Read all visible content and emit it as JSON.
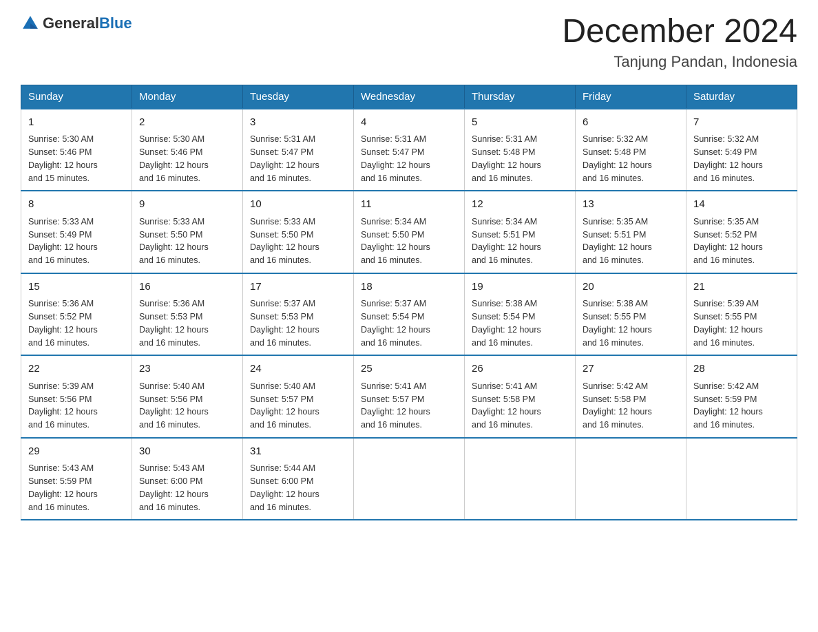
{
  "logo": {
    "text_general": "General",
    "text_blue": "Blue"
  },
  "title": "December 2024",
  "subtitle": "Tanjung Pandan, Indonesia",
  "headers": [
    "Sunday",
    "Monday",
    "Tuesday",
    "Wednesday",
    "Thursday",
    "Friday",
    "Saturday"
  ],
  "weeks": [
    [
      {
        "day": "1",
        "info": "Sunrise: 5:30 AM\nSunset: 5:46 PM\nDaylight: 12 hours\nand 15 minutes."
      },
      {
        "day": "2",
        "info": "Sunrise: 5:30 AM\nSunset: 5:46 PM\nDaylight: 12 hours\nand 16 minutes."
      },
      {
        "day": "3",
        "info": "Sunrise: 5:31 AM\nSunset: 5:47 PM\nDaylight: 12 hours\nand 16 minutes."
      },
      {
        "day": "4",
        "info": "Sunrise: 5:31 AM\nSunset: 5:47 PM\nDaylight: 12 hours\nand 16 minutes."
      },
      {
        "day": "5",
        "info": "Sunrise: 5:31 AM\nSunset: 5:48 PM\nDaylight: 12 hours\nand 16 minutes."
      },
      {
        "day": "6",
        "info": "Sunrise: 5:32 AM\nSunset: 5:48 PM\nDaylight: 12 hours\nand 16 minutes."
      },
      {
        "day": "7",
        "info": "Sunrise: 5:32 AM\nSunset: 5:49 PM\nDaylight: 12 hours\nand 16 minutes."
      }
    ],
    [
      {
        "day": "8",
        "info": "Sunrise: 5:33 AM\nSunset: 5:49 PM\nDaylight: 12 hours\nand 16 minutes."
      },
      {
        "day": "9",
        "info": "Sunrise: 5:33 AM\nSunset: 5:50 PM\nDaylight: 12 hours\nand 16 minutes."
      },
      {
        "day": "10",
        "info": "Sunrise: 5:33 AM\nSunset: 5:50 PM\nDaylight: 12 hours\nand 16 minutes."
      },
      {
        "day": "11",
        "info": "Sunrise: 5:34 AM\nSunset: 5:50 PM\nDaylight: 12 hours\nand 16 minutes."
      },
      {
        "day": "12",
        "info": "Sunrise: 5:34 AM\nSunset: 5:51 PM\nDaylight: 12 hours\nand 16 minutes."
      },
      {
        "day": "13",
        "info": "Sunrise: 5:35 AM\nSunset: 5:51 PM\nDaylight: 12 hours\nand 16 minutes."
      },
      {
        "day": "14",
        "info": "Sunrise: 5:35 AM\nSunset: 5:52 PM\nDaylight: 12 hours\nand 16 minutes."
      }
    ],
    [
      {
        "day": "15",
        "info": "Sunrise: 5:36 AM\nSunset: 5:52 PM\nDaylight: 12 hours\nand 16 minutes."
      },
      {
        "day": "16",
        "info": "Sunrise: 5:36 AM\nSunset: 5:53 PM\nDaylight: 12 hours\nand 16 minutes."
      },
      {
        "day": "17",
        "info": "Sunrise: 5:37 AM\nSunset: 5:53 PM\nDaylight: 12 hours\nand 16 minutes."
      },
      {
        "day": "18",
        "info": "Sunrise: 5:37 AM\nSunset: 5:54 PM\nDaylight: 12 hours\nand 16 minutes."
      },
      {
        "day": "19",
        "info": "Sunrise: 5:38 AM\nSunset: 5:54 PM\nDaylight: 12 hours\nand 16 minutes."
      },
      {
        "day": "20",
        "info": "Sunrise: 5:38 AM\nSunset: 5:55 PM\nDaylight: 12 hours\nand 16 minutes."
      },
      {
        "day": "21",
        "info": "Sunrise: 5:39 AM\nSunset: 5:55 PM\nDaylight: 12 hours\nand 16 minutes."
      }
    ],
    [
      {
        "day": "22",
        "info": "Sunrise: 5:39 AM\nSunset: 5:56 PM\nDaylight: 12 hours\nand 16 minutes."
      },
      {
        "day": "23",
        "info": "Sunrise: 5:40 AM\nSunset: 5:56 PM\nDaylight: 12 hours\nand 16 minutes."
      },
      {
        "day": "24",
        "info": "Sunrise: 5:40 AM\nSunset: 5:57 PM\nDaylight: 12 hours\nand 16 minutes."
      },
      {
        "day": "25",
        "info": "Sunrise: 5:41 AM\nSunset: 5:57 PM\nDaylight: 12 hours\nand 16 minutes."
      },
      {
        "day": "26",
        "info": "Sunrise: 5:41 AM\nSunset: 5:58 PM\nDaylight: 12 hours\nand 16 minutes."
      },
      {
        "day": "27",
        "info": "Sunrise: 5:42 AM\nSunset: 5:58 PM\nDaylight: 12 hours\nand 16 minutes."
      },
      {
        "day": "28",
        "info": "Sunrise: 5:42 AM\nSunset: 5:59 PM\nDaylight: 12 hours\nand 16 minutes."
      }
    ],
    [
      {
        "day": "29",
        "info": "Sunrise: 5:43 AM\nSunset: 5:59 PM\nDaylight: 12 hours\nand 16 minutes."
      },
      {
        "day": "30",
        "info": "Sunrise: 5:43 AM\nSunset: 6:00 PM\nDaylight: 12 hours\nand 16 minutes."
      },
      {
        "day": "31",
        "info": "Sunrise: 5:44 AM\nSunset: 6:00 PM\nDaylight: 12 hours\nand 16 minutes."
      },
      {
        "day": "",
        "info": ""
      },
      {
        "day": "",
        "info": ""
      },
      {
        "day": "",
        "info": ""
      },
      {
        "day": "",
        "info": ""
      }
    ]
  ]
}
